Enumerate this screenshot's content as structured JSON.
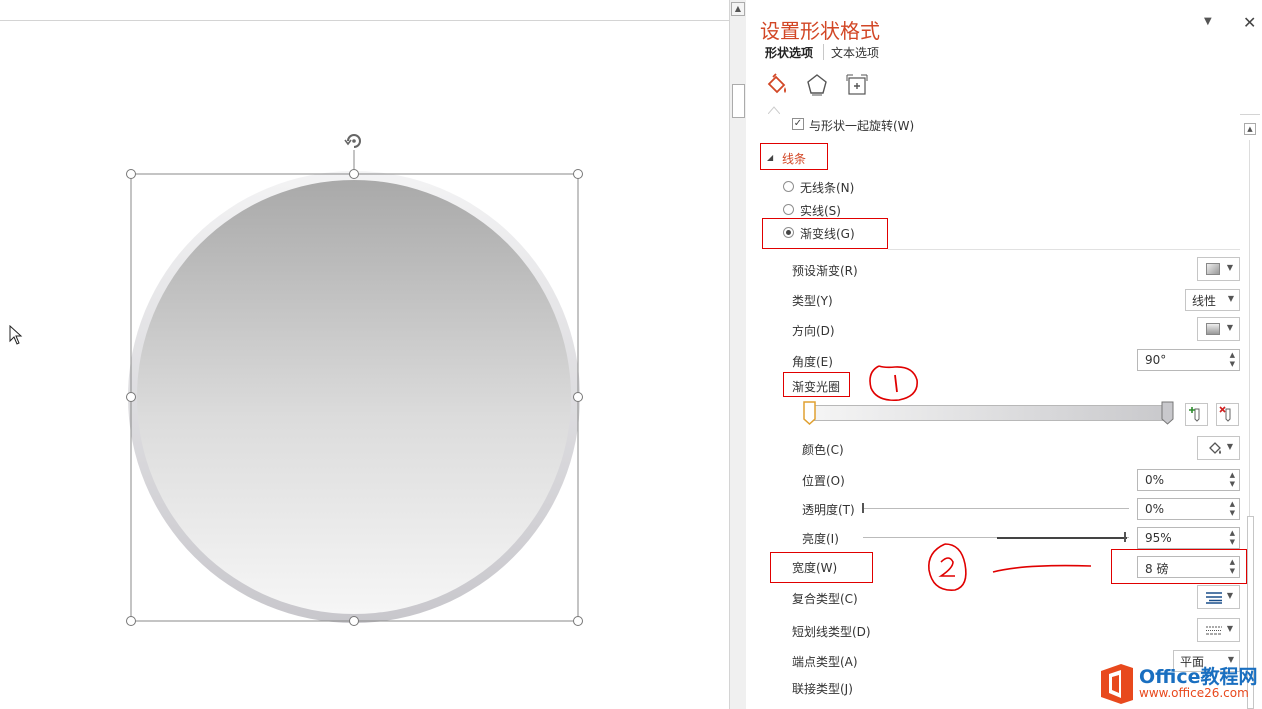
{
  "pane": {
    "title": "设置形状格式",
    "tabs": [
      {
        "label": "形状选项",
        "active": true
      },
      {
        "label": "文本选项",
        "active": false
      }
    ],
    "icons": [
      "fill-line-icon",
      "effects-icon",
      "size-properties-icon"
    ],
    "rotate_with_shape": {
      "label": "与形状一起旋转(W)",
      "checked": true
    },
    "line_section": {
      "label": "线条",
      "expanded": true
    },
    "line_options": [
      {
        "label": "无线条(N)",
        "selected": false
      },
      {
        "label": "实线(S)",
        "selected": false
      },
      {
        "label": "渐变线(G)",
        "selected": true
      }
    ],
    "fields": {
      "preset_gradient": {
        "label": "预设渐变(R)"
      },
      "type": {
        "label": "类型(Y)",
        "value": "线性"
      },
      "direction": {
        "label": "方向(D)"
      },
      "angle": {
        "label": "角度(E)",
        "value": "90°"
      },
      "gradient_stops": {
        "label": "渐变光圈"
      },
      "color": {
        "label": "颜色(C)"
      },
      "position": {
        "label": "位置(O)",
        "value": "0%"
      },
      "transparency": {
        "label": "透明度(T)",
        "value": "0%",
        "level": 0
      },
      "brightness": {
        "label": "亮度(I)",
        "value": "95%",
        "level": 0.95
      },
      "width": {
        "label": "宽度(W)",
        "value": "8 磅"
      },
      "compound_type": {
        "label": "复合类型(C)"
      },
      "dash_type": {
        "label": "短划线类型(D)"
      },
      "cap_type": {
        "label": "端点类型(A)",
        "value": "平面"
      },
      "join_type": {
        "label": "联接类型(J)"
      }
    }
  },
  "annotations": {
    "mark_1": "1",
    "mark_2": "2"
  },
  "logo": {
    "brand_top": "Office教程网",
    "brand_bottom": "www.office26.com"
  },
  "colors": {
    "accent": "#d24726",
    "highlight_box": "#e00000",
    "logo_orange": "#e8491d",
    "logo_blue": "#1a6fc0"
  }
}
